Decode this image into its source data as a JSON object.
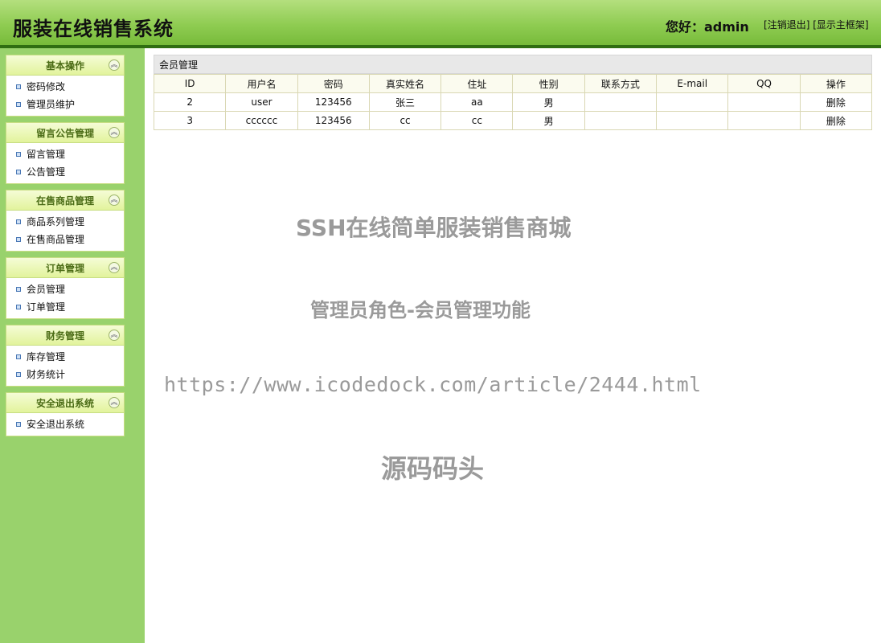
{
  "header": {
    "title": "服装在线销售系统",
    "greeting": "您好：admin",
    "logout_label": "注销退出",
    "show_frame_label": "显示主框架"
  },
  "sidebar": [
    {
      "label": "基本操作",
      "toggle": "︽",
      "items": [
        "密码修改",
        "管理员维护"
      ]
    },
    {
      "label": "留言公告管理",
      "toggle": "︽",
      "items": [
        "留言管理",
        "公告管理"
      ]
    },
    {
      "label": "在售商品管理",
      "toggle": "︽",
      "items": [
        "商品系列管理",
        "在售商品管理"
      ]
    },
    {
      "label": "订单管理",
      "toggle": "︽",
      "items": [
        "会员管理",
        "订单管理"
      ]
    },
    {
      "label": "财务管理",
      "toggle": "︽",
      "items": [
        "库存管理",
        "财务统计"
      ]
    },
    {
      "label": "安全退出系统",
      "toggle": "︽",
      "items": [
        "安全退出系统"
      ]
    }
  ],
  "main": {
    "section_title": "会员管理",
    "columns": [
      "ID",
      "用户名",
      "密码",
      "真实姓名",
      "住址",
      "性别",
      "联系方式",
      "E-mail",
      "QQ",
      "操作"
    ],
    "rows": [
      [
        "2",
        "user",
        "123456",
        "张三",
        "aa",
        "男",
        "",
        "",
        "",
        "删除"
      ],
      [
        "3",
        "cccccc",
        "123456",
        "cc",
        "cc",
        "男",
        "",
        "",
        "",
        "删除"
      ]
    ]
  },
  "watermark": {
    "line1": "SSH在线简单服装销售商城",
    "line2": "管理员角色-会员管理功能",
    "line3": "https://www.icodedock.com/article/2444.html",
    "line4": "源码码头"
  },
  "colors": {
    "header_green": "#8fcc52",
    "sidebar_green": "#99d26c",
    "header_border": "#2f6e12"
  }
}
